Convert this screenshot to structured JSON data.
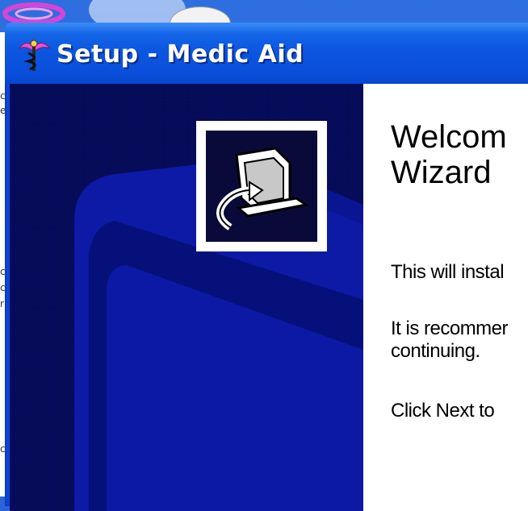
{
  "window": {
    "title": "Setup - Medic Aid"
  },
  "wizard": {
    "heading_line1": "Welcom",
    "heading_line2": "Wizard",
    "paragraph1": "This will instal",
    "paragraph2_line1": "It is recommer",
    "paragraph2_line2": "continuing.",
    "paragraph3": "Click Next to"
  },
  "desktop": {
    "left_strip_chars": [
      "c",
      "e",
      "c",
      "c",
      "r",
      "c"
    ]
  },
  "colors": {
    "titlebar": "#0a4fdb",
    "side_panel": "#060d5e",
    "side_art": "#0c1aa6",
    "title_text": "#ffffff"
  },
  "icons": {
    "title_icon": "caduceus-icon",
    "wizard_logo": "computer-install-icon"
  }
}
